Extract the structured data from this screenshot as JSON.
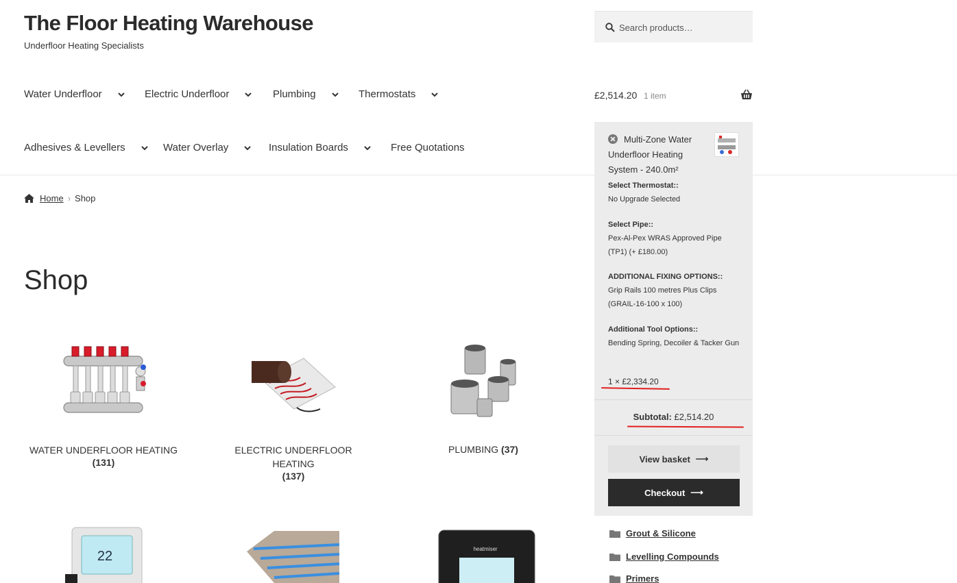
{
  "site": {
    "title": "The Floor Heating Warehouse",
    "tagline": "Underfloor Heating Specialists"
  },
  "search": {
    "placeholder": "Search products…"
  },
  "nav": {
    "items": [
      {
        "label": "Water Underfloor",
        "has_dropdown": true
      },
      {
        "label": "Electric Underfloor",
        "has_dropdown": true
      },
      {
        "label": "Plumbing",
        "has_dropdown": true
      },
      {
        "label": "Thermostats",
        "has_dropdown": true
      },
      {
        "label": "Adhesives & Levellers",
        "has_dropdown": true
      },
      {
        "label": "Water Overlay",
        "has_dropdown": true
      },
      {
        "label": "Insulation Boards",
        "has_dropdown": true
      },
      {
        "label": "Free Quotations",
        "has_dropdown": false
      }
    ]
  },
  "cart": {
    "amount": "£2,514.20",
    "count": "1 item",
    "item": {
      "name": "Multi-Zone Water Underfloor Heating System - 240.0m²",
      "variations": [
        {
          "key": "Select Thermostat::",
          "value": "No Upgrade Selected"
        },
        {
          "key": "Select Pipe::",
          "value": "Pex-Al-Pex WRAS Approved Pipe (TP1) (+ £180.00)"
        },
        {
          "key": "ADDITIONAL FIXING OPTIONS::",
          "value": "Grip Rails 100 metres Plus Clips (GRAIL-16-100 x 100)"
        },
        {
          "key": "Additional Tool Options::",
          "value": "Bending Spring, Decoiler & Tacker Gun"
        }
      ],
      "quantity_line": "1 × £2,334.20"
    },
    "subtotal_label": "Subtotal:",
    "subtotal_value": "£2,514.20",
    "view_basket": "View basket",
    "checkout": "Checkout"
  },
  "breadcrumb": {
    "home": "Home",
    "current": "Shop"
  },
  "page_title": "Shop",
  "categories": [
    {
      "name": "WATER UNDERFLOOR HEATING",
      "count": "(131)"
    },
    {
      "name": "ELECTRIC UNDERFLOOR HEATING",
      "count": "(137)"
    },
    {
      "name": "PLUMBING",
      "count": "(37)"
    }
  ],
  "sidebar_categories": [
    "Grout & Silicone",
    "Levelling Compounds",
    "Primers"
  ],
  "colors": {
    "accent_line": "#e21f1f",
    "checkout_bg": "#2b2b2b",
    "mini_cart_bg": "#ececec"
  }
}
